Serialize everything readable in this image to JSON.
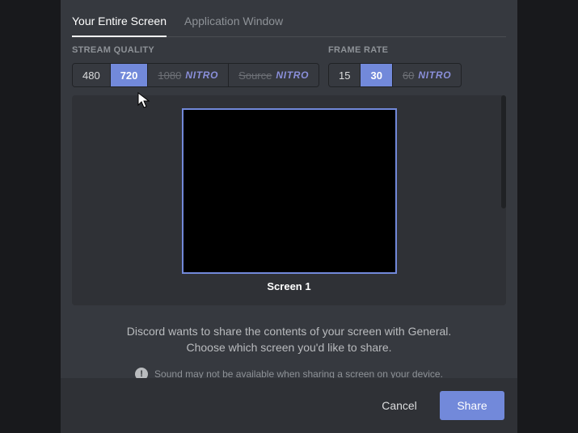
{
  "tabs": {
    "entire_screen": "Your Entire Screen",
    "app_window": "Application Window"
  },
  "quality": {
    "label": "STREAM QUALITY",
    "opt480": "480",
    "opt720": "720",
    "opt1080": "1080",
    "optSource": "Source",
    "nitro": "NITRO"
  },
  "framerate": {
    "label": "FRAME RATE",
    "opt15": "15",
    "opt30": "30",
    "opt60": "60",
    "nitro": "NITRO"
  },
  "preview": {
    "screen_label": "Screen 1"
  },
  "info": {
    "line1": "Discord wants to share the contents of your screen with General.",
    "line2": "Choose which screen you'd like to share.",
    "sound_warning": "Sound may not be available when sharing a screen on your device."
  },
  "footer": {
    "cancel": "Cancel",
    "share": "Share"
  }
}
